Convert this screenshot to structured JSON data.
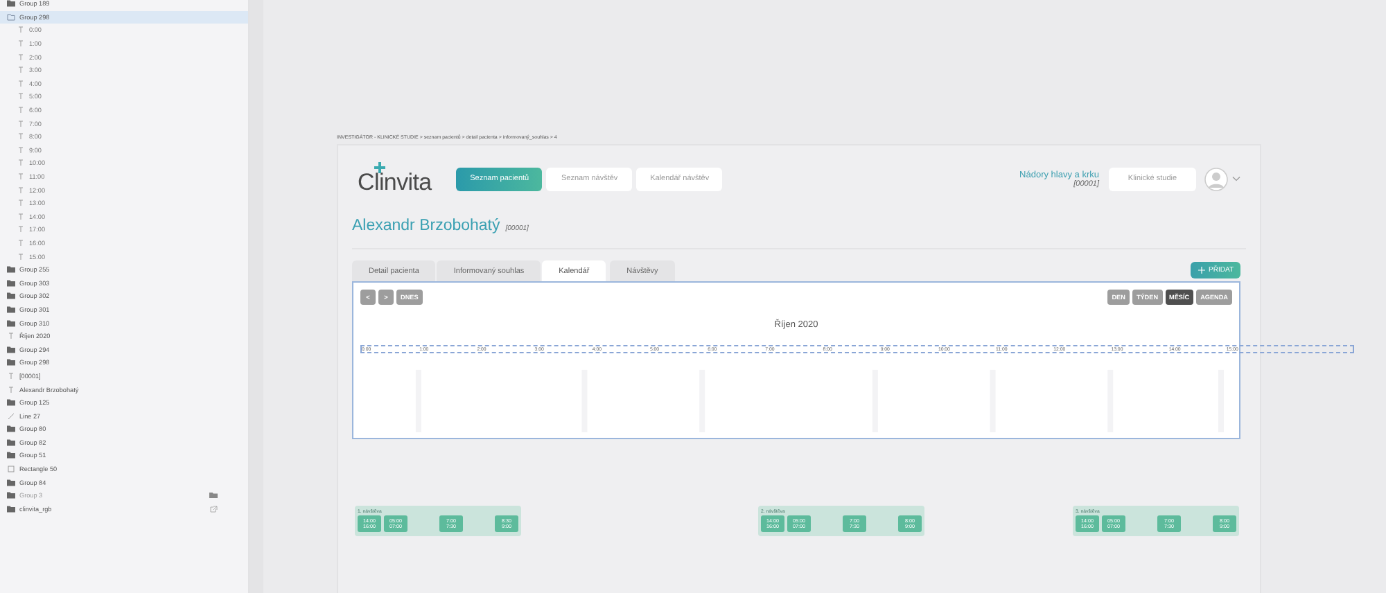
{
  "layers": [
    {
      "name": "Group 189",
      "kind": "group",
      "selected": false,
      "hidden": false
    },
    {
      "name": "Group 298",
      "kind": "group",
      "selected": true,
      "hidden": false,
      "children": [
        {
          "name": "0:00",
          "kind": "text"
        },
        {
          "name": "1:00",
          "kind": "text"
        },
        {
          "name": "2:00",
          "kind": "text"
        },
        {
          "name": "3:00",
          "kind": "text"
        },
        {
          "name": "4:00",
          "kind": "text"
        },
        {
          "name": "5:00",
          "kind": "text"
        },
        {
          "name": "6:00",
          "kind": "text"
        },
        {
          "name": "7:00",
          "kind": "text"
        },
        {
          "name": "8:00",
          "kind": "text"
        },
        {
          "name": "9:00",
          "kind": "text"
        },
        {
          "name": "10:00",
          "kind": "text"
        },
        {
          "name": "11:00",
          "kind": "text"
        },
        {
          "name": "12:00",
          "kind": "text"
        },
        {
          "name": "13:00",
          "kind": "text"
        },
        {
          "name": "14:00",
          "kind": "text"
        },
        {
          "name": "17:00",
          "kind": "text"
        },
        {
          "name": "16:00",
          "kind": "text"
        },
        {
          "name": "15:00",
          "kind": "text"
        }
      ]
    },
    {
      "name": "Group 255",
      "kind": "group",
      "selected": false,
      "hidden": false
    },
    {
      "name": "Group 303",
      "kind": "group",
      "selected": false,
      "hidden": false
    },
    {
      "name": "Group 302",
      "kind": "group",
      "selected": false,
      "hidden": false
    },
    {
      "name": "Group 301",
      "kind": "group",
      "selected": false,
      "hidden": false
    },
    {
      "name": "Group 310",
      "kind": "group",
      "selected": false,
      "hidden": false
    },
    {
      "name": "Říjen 2020",
      "kind": "text",
      "selected": false,
      "hidden": false
    },
    {
      "name": "Group 294",
      "kind": "group",
      "selected": false,
      "hidden": false
    },
    {
      "name": "Group 298",
      "kind": "group",
      "selected": false,
      "hidden": false
    },
    {
      "name": "[00001]",
      "kind": "text",
      "selected": false,
      "hidden": false
    },
    {
      "name": "Alexandr Brzobohatý",
      "kind": "text",
      "selected": false,
      "hidden": false
    },
    {
      "name": "Group 125",
      "kind": "group",
      "selected": false,
      "hidden": false
    },
    {
      "name": "Line 27",
      "kind": "line",
      "selected": false,
      "hidden": false
    },
    {
      "name": "Group 80",
      "kind": "group",
      "selected": false,
      "hidden": false
    },
    {
      "name": "Group 82",
      "kind": "group",
      "selected": false,
      "hidden": false
    },
    {
      "name": "Group 51",
      "kind": "group",
      "selected": false,
      "hidden": false
    },
    {
      "name": "Rectangle 50",
      "kind": "rect",
      "selected": false,
      "hidden": false
    },
    {
      "name": "Group 84",
      "kind": "group",
      "selected": false,
      "hidden": false
    },
    {
      "name": "Group 3",
      "kind": "group",
      "selected": false,
      "hidden": true
    },
    {
      "name": "clinvita_rgb",
      "kind": "group",
      "selected": false,
      "hidden": false,
      "link": true
    }
  ],
  "artboard": {
    "title": "INVESTIGÁTOR - KLINICKÉ STUDIE > seznam pacientů > detail pacienta > informovaný_souhlas > 4",
    "logo": "Clinvita",
    "nav": [
      {
        "label": "Seznam pacientů",
        "selected": true
      },
      {
        "label": "Seznam návštěv",
        "selected": false
      },
      {
        "label": "Kalendář návštěv",
        "selected": false
      }
    ],
    "study": {
      "name": "Nádory hlavy a krku",
      "code": "[00001]"
    },
    "study_button": "Klinické studie",
    "patient": {
      "name": "Alexandr Brzobohatý",
      "code": "[00001]"
    },
    "tabs": [
      {
        "label": "Detail pacienta",
        "selected": false
      },
      {
        "label": "Informovaný souhlas",
        "selected": false
      },
      {
        "label": "Kalendář",
        "selected": true
      },
      {
        "label": "Návštěvy",
        "selected": false
      }
    ],
    "add_button": "PŘIDAT",
    "calendar": {
      "prev": "<",
      "next": ">",
      "today": "DNES",
      "views": [
        {
          "label": "DEN",
          "selected": false
        },
        {
          "label": "TÝDEN",
          "selected": false
        },
        {
          "label": "MĚSÍC",
          "selected": true
        },
        {
          "label": "AGENDA",
          "selected": false
        }
      ],
      "title": "Říjen 2020",
      "hours": [
        "0:00",
        "1:00",
        "2:00",
        "3:00",
        "4:00",
        "5:00",
        "6:00",
        "7:00",
        "8:00",
        "9:00",
        "10:00",
        "11:00",
        "12:00",
        "13:00",
        "14:00",
        "15:00"
      ]
    },
    "visits": [
      {
        "title": "1. návštěva",
        "slots": [
          [
            "14:00",
            "16:00"
          ],
          [
            "05:00",
            "07:00"
          ],
          [
            "7:00",
            "7:30"
          ],
          [
            "8:30",
            "9:00"
          ]
        ]
      },
      {
        "title": "2. návštěva",
        "slots": [
          [
            "14:00",
            "16:00"
          ],
          [
            "05:00",
            "07:00"
          ],
          [
            "7:00",
            "7:30"
          ],
          [
            "8:00",
            "9:00"
          ]
        ]
      },
      {
        "title": "3. návštěva",
        "slots": [
          [
            "14:00",
            "16:00"
          ],
          [
            "05:00",
            "07:00"
          ],
          [
            "7:00",
            "7:30"
          ],
          [
            "8:00",
            "9:00"
          ]
        ]
      }
    ]
  }
}
